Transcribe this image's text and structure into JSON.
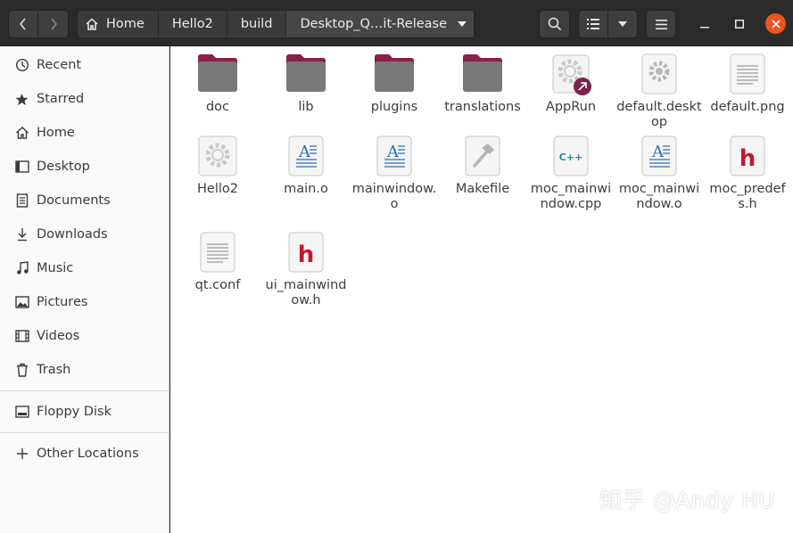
{
  "header": {
    "breadcrumbs": [
      "Home",
      "Hello2",
      "build",
      "Desktop_Q…it-Release"
    ]
  },
  "sidebar": {
    "items": [
      {
        "label": "Recent",
        "icon": "clock-icon"
      },
      {
        "label": "Starred",
        "icon": "star-icon"
      },
      {
        "label": "Home",
        "icon": "home-icon"
      },
      {
        "label": "Desktop",
        "icon": "desktop-icon"
      },
      {
        "label": "Documents",
        "icon": "document-icon"
      },
      {
        "label": "Downloads",
        "icon": "download-icon"
      },
      {
        "label": "Music",
        "icon": "music-icon"
      },
      {
        "label": "Pictures",
        "icon": "picture-icon"
      },
      {
        "label": "Videos",
        "icon": "video-icon"
      },
      {
        "label": "Trash",
        "icon": "trash-icon"
      },
      {
        "label": "Floppy Disk",
        "icon": "floppy-disk-icon"
      },
      {
        "label": "Other Locations",
        "icon": "plus-icon"
      }
    ]
  },
  "files": [
    {
      "name": "doc",
      "type": "folder"
    },
    {
      "name": "lib",
      "type": "folder"
    },
    {
      "name": "plugins",
      "type": "folder"
    },
    {
      "name": "translations",
      "type": "folder"
    },
    {
      "name": "AppRun",
      "type": "symlink-executable"
    },
    {
      "name": "default.desktop",
      "type": "desktop-file"
    },
    {
      "name": "default.png",
      "type": "text"
    },
    {
      "name": "Hello2",
      "type": "executable"
    },
    {
      "name": "main.o",
      "type": "object"
    },
    {
      "name": "mainwindow.o",
      "type": "object"
    },
    {
      "name": "Makefile",
      "type": "makefile"
    },
    {
      "name": "moc_mainwindow.cpp",
      "type": "cpp"
    },
    {
      "name": "moc_mainwindow.o",
      "type": "object"
    },
    {
      "name": "moc_predefs.h",
      "type": "header"
    },
    {
      "name": "qt.conf",
      "type": "text"
    },
    {
      "name": "ui_mainwindow.h",
      "type": "header"
    }
  ],
  "watermark": "知乎 @Andy HU",
  "colors": {
    "header_bg": "#2b2b2b",
    "folder_top": "#8b1f4b",
    "folder_body": "#787878",
    "close_button": "#e95420",
    "header_h": "#c7162b"
  }
}
